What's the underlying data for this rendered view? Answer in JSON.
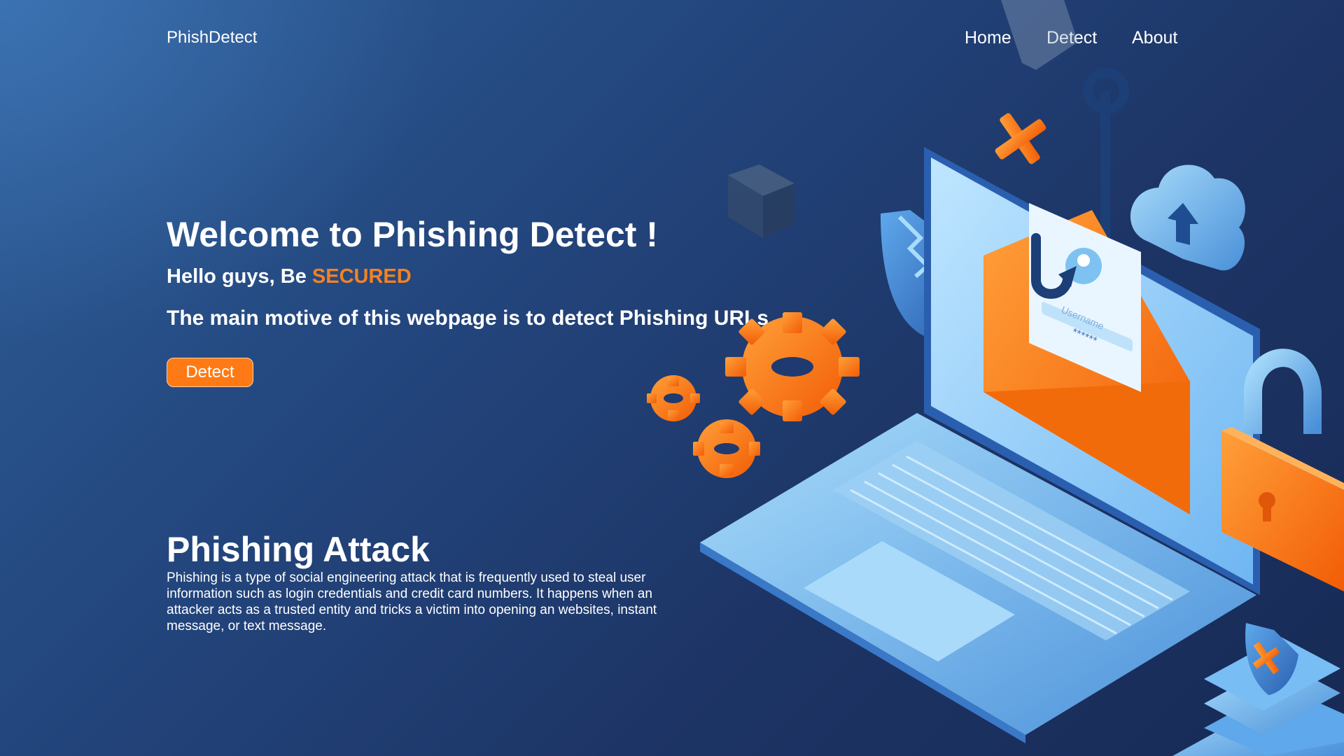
{
  "brand": "PhishDetect",
  "nav": {
    "home": "Home",
    "detect": "Detect",
    "about": "About"
  },
  "hero": {
    "title": "Welcome to Phishing Detect !",
    "hello_prefix": "Hello guys, Be ",
    "hello_accent": "SECURED",
    "motive": "The main motive of this webpage is to detect Phishing URLs",
    "button_label": "Detect"
  },
  "section": {
    "title": "Phishing Attack",
    "body": "Phishing is a type of social engineering attack that is frequently used to steal user information  such as login credentials and  credit card numbers. It happens when an attacker acts  as a trusted  entity and tricks  a victim into  opening an websites, instant message, or text message."
  },
  "illustration": {
    "icons": [
      "laptop-icon",
      "envelope-icon",
      "fishing-hook-icon",
      "cloud-upload-icon",
      "padlock-icon",
      "shield-icon",
      "gear-icon",
      "server-stack-icon",
      "cross-mark-icon",
      "cube-icon"
    ],
    "form_placeholder": "Username",
    "form_password_mask": "******"
  },
  "colors": {
    "accent": "#f5821f",
    "button": "#ff7a14",
    "bg_dark": "#172a55",
    "bg_light": "#2f5f98"
  }
}
